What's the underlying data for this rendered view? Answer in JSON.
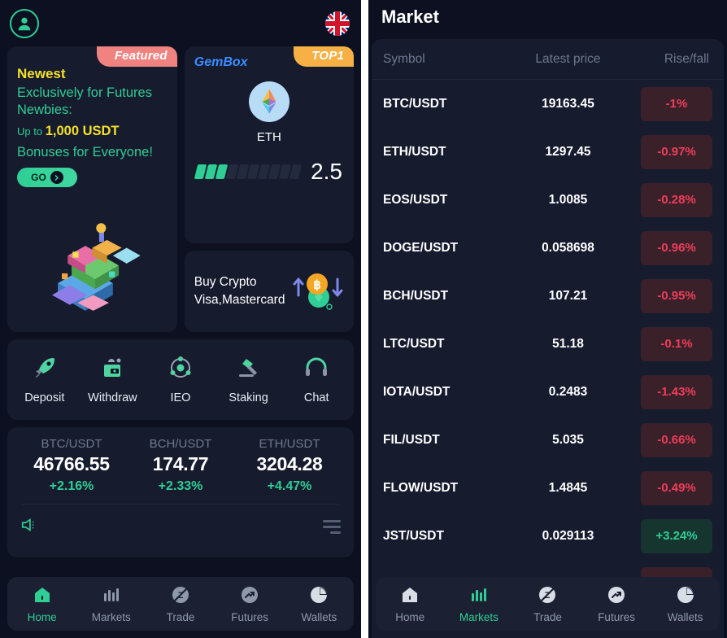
{
  "left": {
    "topbar": {
      "avatar_icon": "user-avatar-icon",
      "language_icon": "uk-flag-icon"
    },
    "featured_card": {
      "badge": "Featured",
      "newest": "Newest",
      "headline": "Exclusively for Futures Newbies:",
      "upto_prefix": "Up to",
      "upto_amount": "1,000 USDT",
      "bonus": "Bonuses for Everyone!",
      "go_label": "GO"
    },
    "gembox_card": {
      "title": "GemBox",
      "badge": "TOP1",
      "coin": "ETH",
      "score": "2.5",
      "bars_total": 10,
      "bars_filled": 3
    },
    "buy_card": {
      "line1": "Buy Crypto",
      "line2": "Visa,Mastercard"
    },
    "shortcuts": [
      {
        "label": "Deposit",
        "icon": "rocket-icon"
      },
      {
        "label": "Withdraw",
        "icon": "withdraw-icon"
      },
      {
        "label": "IEO",
        "icon": "atom-icon"
      },
      {
        "label": "Staking",
        "icon": "gavel-icon"
      },
      {
        "label": "Chat",
        "icon": "headset-icon"
      }
    ],
    "tickers": [
      {
        "symbol": "BTC/USDT",
        "price": "46766.55",
        "change": "+2.16%"
      },
      {
        "symbol": "BCH/USDT",
        "price": "174.77",
        "change": "+2.33%"
      },
      {
        "symbol": "ETH/USDT",
        "price": "3204.28",
        "change": "+4.47%"
      }
    ],
    "announcement": {
      "speaker_icon": "megaphone-icon",
      "menu_icon": "list-menu-icon"
    },
    "nav": [
      {
        "label": "Home",
        "icon": "home-icon",
        "active": true
      },
      {
        "label": "Markets",
        "icon": "bar-chart-icon",
        "active": false
      },
      {
        "label": "Trade",
        "icon": "trade-icon",
        "active": false
      },
      {
        "label": "Futures",
        "icon": "futures-arrow-icon",
        "active": false
      },
      {
        "label": "Wallets",
        "icon": "pie-wallet-icon",
        "active": false
      }
    ]
  },
  "right": {
    "title": "Market",
    "columns": {
      "symbol": "Symbol",
      "price": "Latest price",
      "change": "Rise/fall"
    },
    "rows": [
      {
        "symbol": "BTC/USDT",
        "price": "19163.45",
        "change": "-1%",
        "dir": "neg"
      },
      {
        "symbol": "ETH/USDT",
        "price": "1297.45",
        "change": "-0.97%",
        "dir": "neg"
      },
      {
        "symbol": "EOS/USDT",
        "price": "1.0085",
        "change": "-0.28%",
        "dir": "neg"
      },
      {
        "symbol": "DOGE/USDT",
        "price": "0.058698",
        "change": "-0.96%",
        "dir": "neg"
      },
      {
        "symbol": "BCH/USDT",
        "price": "107.21",
        "change": "-0.95%",
        "dir": "neg"
      },
      {
        "symbol": "LTC/USDT",
        "price": "51.18",
        "change": "-0.1%",
        "dir": "neg"
      },
      {
        "symbol": "IOTA/USDT",
        "price": "0.2483",
        "change": "-1.43%",
        "dir": "neg"
      },
      {
        "symbol": "FIL/USDT",
        "price": "5.035",
        "change": "-0.66%",
        "dir": "neg"
      },
      {
        "symbol": "FLOW/USDT",
        "price": "1.4845",
        "change": "-0.49%",
        "dir": "neg"
      },
      {
        "symbol": "JST/USDT",
        "price": "0.029113",
        "change": "+3.24%",
        "dir": "pos"
      }
    ],
    "nav": [
      {
        "label": "Home",
        "icon": "home-icon",
        "active": false
      },
      {
        "label": "Markets",
        "icon": "bar-chart-icon",
        "active": true
      },
      {
        "label": "Trade",
        "icon": "trade-icon",
        "active": false
      },
      {
        "label": "Futures",
        "icon": "futures-arrow-icon",
        "active": false
      },
      {
        "label": "Wallets",
        "icon": "pie-wallet-icon",
        "active": false
      }
    ]
  },
  "colors": {
    "bg": "#0c1020",
    "card": "#161b2e",
    "accent_green": "#2fce94",
    "yellow": "#f3e02a",
    "red": "#ef3d5a",
    "badge_featured": "#f0837f",
    "badge_top1": "#f6b045",
    "blue": "#3c8dff"
  }
}
